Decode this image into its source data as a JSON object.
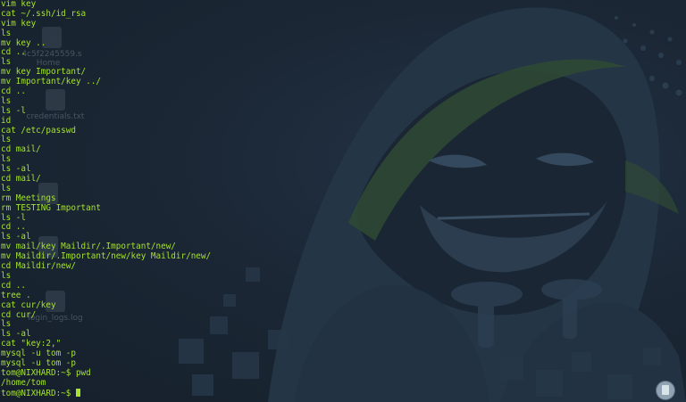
{
  "desktop": {
    "icons": [
      {
        "label": "4c5f2245559.s",
        "icon": "folder-icon"
      },
      {
        "label": "Home",
        "icon": "home-folder-icon"
      },
      {
        "label": "credentials.txt",
        "icon": "text-file-icon"
      },
      {
        "label": "",
        "icon": "trash-icon"
      },
      {
        "label": "",
        "icon": "drive-icon"
      },
      {
        "label": "login_logs.log",
        "icon": "log-file-icon"
      }
    ]
  },
  "terminal": {
    "lines": [
      "vim key",
      "cat ~/.ssh/id_rsa",
      "vim key",
      "ls",
      "mv key ..",
      "cd ..",
      "ls",
      "mv key Important/",
      "mv Important/key ../",
      "cd ..",
      "ls",
      "ls -l",
      "id",
      "cat /etc/passwd",
      "ls",
      "cd mail/",
      "ls",
      "ls -al",
      "cd mail/",
      "ls",
      "rm Meetings",
      "rm TESTING Important",
      "ls -l",
      "cd ..",
      "ls -al",
      "mv mail/key Maildir/.Important/new/",
      "mv Maildir/.Important/new/key Maildir/new/",
      "cd Maildir/new/",
      "ls",
      "cd ..",
      "tree .",
      "cat cur/key",
      "cd cur/",
      "ls",
      "ls -al",
      "cat \"key:2,\"",
      "mysql -u tom -p",
      "mysql -u tom -p",
      "tom@NIXHARD:~$ pwd",
      "/home/tom"
    ],
    "prompt": "tom@NIXHARD:~$ ",
    "text_color": "#a6e22e"
  },
  "tray": {
    "icon": "clipboard-icon"
  },
  "colors": {
    "background": "#1a2431",
    "wallpaper_figure": "#2a3a4c",
    "wallpaper_accent": "#3d5a3c"
  }
}
